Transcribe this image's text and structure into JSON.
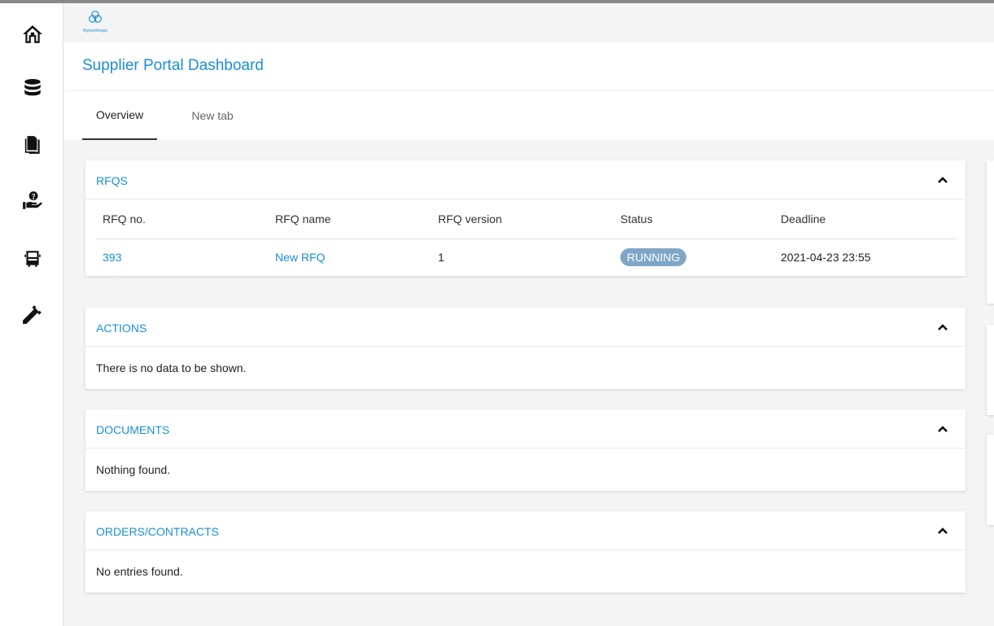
{
  "logo": {
    "text": "thyssenkrupp"
  },
  "page": {
    "title": "Supplier Portal Dashboard"
  },
  "tabs": [
    {
      "label": "Overview"
    },
    {
      "label": "New tab"
    }
  ],
  "nav_icons": [
    "home-icon",
    "database-icon",
    "documents-icon",
    "help-hand-icon",
    "truck-icon",
    "caliper-icon"
  ],
  "panels": {
    "rfqs": {
      "title": "RFQS",
      "columns": [
        "RFQ no.",
        "RFQ name",
        "RFQ version",
        "Status",
        "Deadline"
      ],
      "rows": [
        {
          "no": "393",
          "name": "New RFQ",
          "version": "1",
          "status": "RUNNING",
          "deadline": "2021-04-23 23:55"
        }
      ]
    },
    "actions": {
      "title": "ACTIONS",
      "message": "There is no data to be shown."
    },
    "documents": {
      "title": "DOCUMENTS",
      "message": "Nothing found."
    },
    "orders": {
      "title": "ORDERS/CONTRACTS",
      "message": "No entries found."
    }
  },
  "colors": {
    "accent": "#1a8fd8",
    "status_running": "#7ea6c7"
  }
}
